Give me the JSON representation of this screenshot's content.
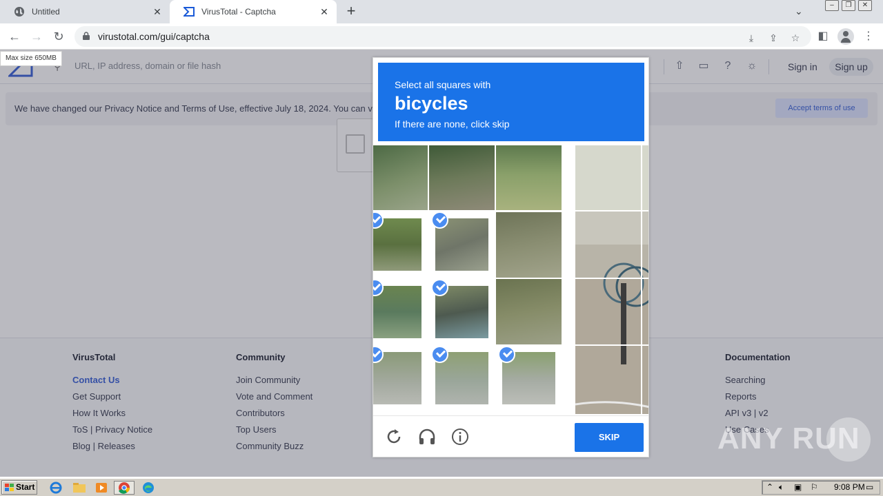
{
  "browser": {
    "tabs": [
      {
        "title": "Untitled"
      },
      {
        "title": "VirusTotal - Captcha"
      }
    ],
    "url": "virustotal.com/gui/captcha"
  },
  "tooltip": "Max size 650MB",
  "vt_header": {
    "search_placeholder": "URL, IP address, domain or file hash",
    "sign_in": "Sign in",
    "sign_up": "Sign up"
  },
  "privacy_banner": {
    "text": "We have changed our Privacy Notice and Terms of Use, effective July 18, 2024. You can v",
    "accept_label": "Accept terms of use"
  },
  "footer": {
    "columns": [
      {
        "heading": "VirusTotal",
        "links": [
          "Contact Us",
          "Get Support",
          "How It Works",
          "ToS | Privacy Notice",
          "Blog | Releases"
        ]
      },
      {
        "heading": "Community",
        "links": [
          "Join Community",
          "Vote and Comment",
          "Contributors",
          "Top Users",
          "Community Buzz"
        ]
      },
      {
        "heading": "Documentation",
        "links": [
          "Searching",
          "Reports",
          "API v3 | v2",
          "Use Cases"
        ]
      }
    ]
  },
  "captcha": {
    "line1": "Select all squares with",
    "target": "bicycles",
    "line3": "If there are none, click skip",
    "skip_label": "SKIP",
    "selected_tiles": 7,
    "accent_color": "#1a73e8",
    "check_color": "#4a8cf0"
  },
  "watermark": "ANY RUN",
  "taskbar": {
    "start_label": "Start",
    "clock": "9:08 PM"
  }
}
